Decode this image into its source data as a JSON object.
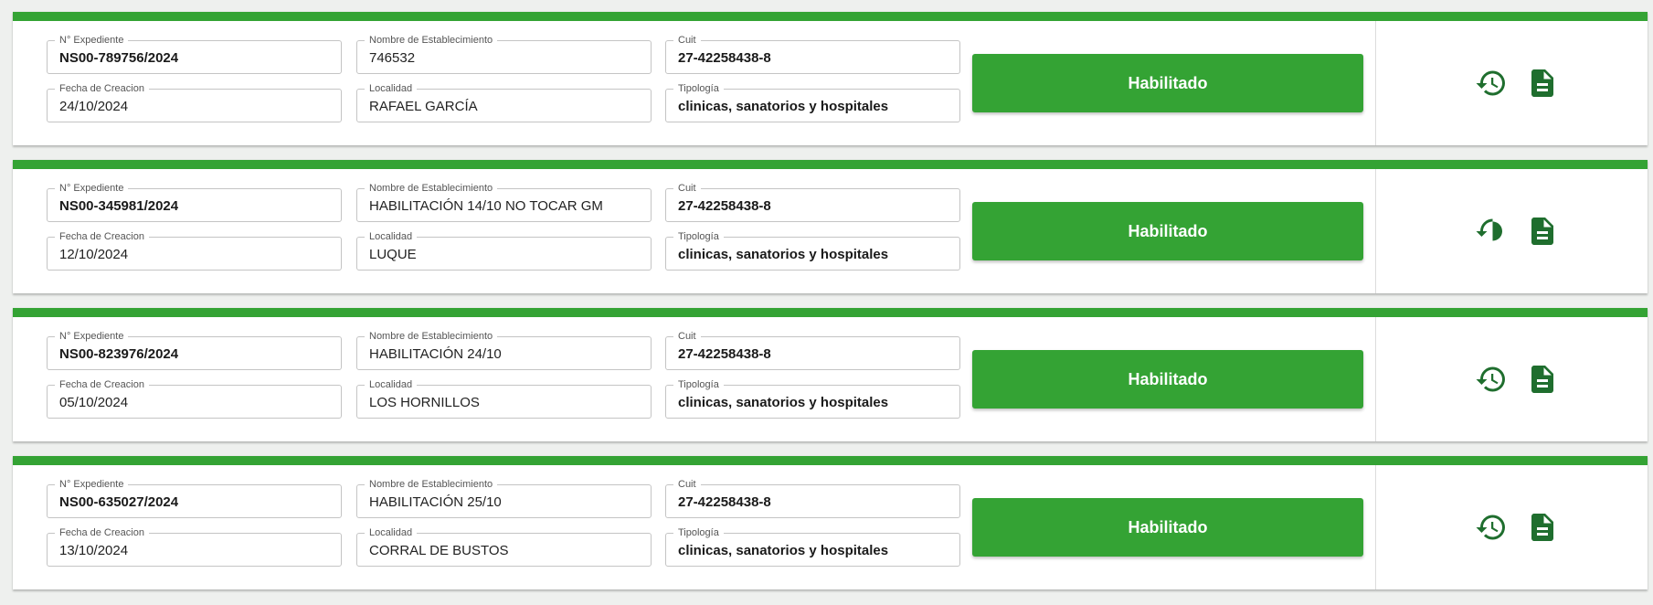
{
  "labels": {
    "expediente": "N° Expediente",
    "nombre": "Nombre de Establecimiento",
    "cuit": "Cuit",
    "fecha": "Fecha de Creacion",
    "localidad": "Localidad",
    "tipologia": "Tipología"
  },
  "records": [
    {
      "expediente": "NS00-789756/2024",
      "nombre": "746532",
      "cuit": "27-42258438-8",
      "fecha": "24/10/2024",
      "localidad": "RAFAEL GARCÍA",
      "tipologia": "clinicas, sanatorios y hospitales",
      "status": "Habilitado"
    },
    {
      "expediente": "NS00-345981/2024",
      "nombre": "HABILITACIÓN 14/10 NO TOCAR GM",
      "cuit": "27-42258438-8",
      "fecha": "12/10/2024",
      "localidad": "LUQUE",
      "tipologia": "clinicas, sanatorios y hospitales",
      "status": "Habilitado"
    },
    {
      "expediente": "NS00-823976/2024",
      "nombre": "HABILITACIÓN 24/10",
      "cuit": "27-42258438-8",
      "fecha": "05/10/2024",
      "localidad": "LOS HORNILLOS",
      "tipologia": "clinicas, sanatorios y hospitales",
      "status": "Habilitado"
    },
    {
      "expediente": "NS00-635027/2024",
      "nombre": "HABILITACIÓN 25/10",
      "cuit": "27-42258438-8",
      "fecha": "13/10/2024",
      "localidad": "CORRAL DE BUSTOS",
      "tipologia": "clinicas, sanatorios y hospitales",
      "status": "Habilitado"
    }
  ],
  "icons": {
    "history": "history-icon",
    "document": "document-icon"
  },
  "colors": {
    "accent": "#34a334",
    "icon": "#1f6e2e"
  }
}
